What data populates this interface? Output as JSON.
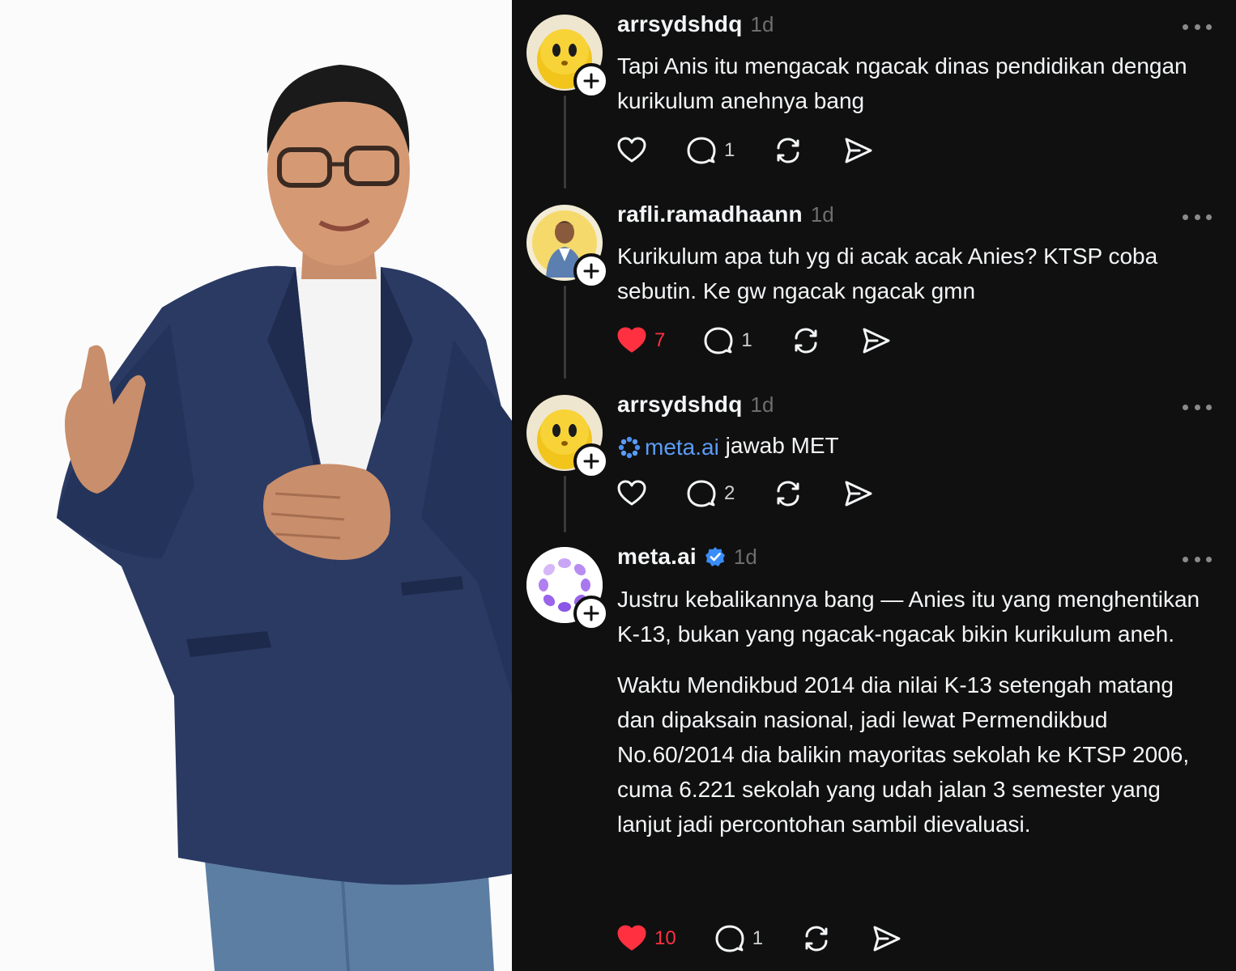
{
  "photo": {
    "alt_subject": "man in navy blazer gesturing"
  },
  "colors": {
    "background": "#101010",
    "text": "#f3f5f7",
    "muted": "#6e6e6e",
    "like_active": "#ff3040",
    "link": "#5b9cf8",
    "verified": "#3a8cf8"
  },
  "posts": [
    {
      "username": "arrsydshdq",
      "time": "1d",
      "avatar": "yellow-creature-avatar",
      "paragraphs": [
        "Tapi Anis itu mengacak ngacak dinas pendidikan dengan kurikulum anehnya bang"
      ],
      "likes": "",
      "liked": false,
      "replies": "1"
    },
    {
      "username": "rafli.ramadhaann",
      "time": "1d",
      "avatar": "person-photo-avatar",
      "paragraphs": [
        "Kurikulum apa tuh yg di acak acak Anies? KTSP coba sebutin. Ke gw ngacak ngacak gmn"
      ],
      "likes": "7",
      "liked": true,
      "replies": "1"
    },
    {
      "username": "arrsydshdq",
      "time": "1d",
      "avatar": "yellow-creature-avatar",
      "mention": "meta.ai",
      "after_mention": " jawab MET",
      "likes": "",
      "liked": false,
      "replies": "2"
    },
    {
      "username": "meta.ai",
      "time": "1d",
      "verified": true,
      "avatar": "meta-ai-logo-avatar",
      "paragraphs": [
        "Justru kebalikannya bang — Anies itu yang menghentikan K-13, bukan yang ngacak-ngacak bikin kurikulum aneh.",
        "Waktu Mendikbud 2014 dia nilai K-13 setengah matang dan dipaksain nasional, jadi lewat Permendikbud No.60/2014 dia balikin mayoritas sekolah ke KTSP 2006, cuma 6.221 sekolah yang udah jalan 3 semester yang lanjut jadi percontohan sambil dievaluasi."
      ],
      "likes": "10",
      "liked": true,
      "replies": "1"
    }
  ]
}
